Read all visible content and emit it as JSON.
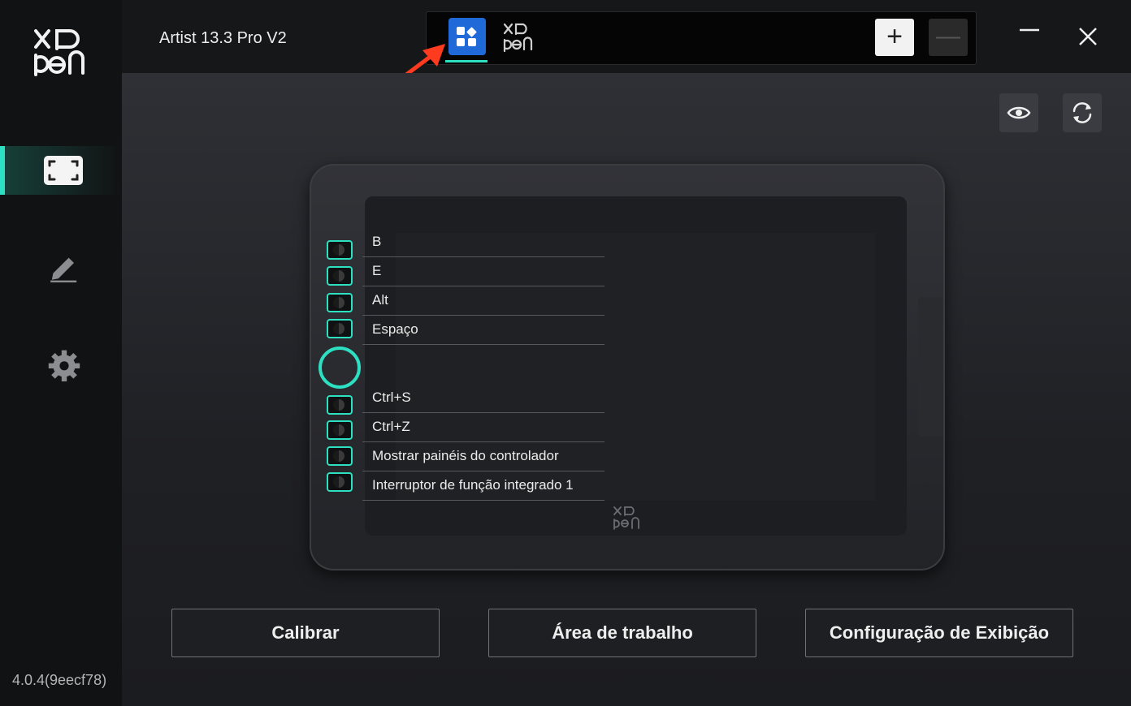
{
  "app": {
    "device_name": "Artist 13.3 Pro V2",
    "version": "4.0.4(9eecf78)",
    "brand_accent": "#2ee0c2"
  },
  "sidebar": {
    "items": [
      {
        "name": "display-area",
        "icon": "fullscreen-frame-icon",
        "active": true
      },
      {
        "name": "pen",
        "icon": "pen-icon",
        "active": false
      },
      {
        "name": "settings",
        "icon": "gear-icon",
        "active": false
      }
    ]
  },
  "tabs": {
    "apps_icon": "app-grid-icon",
    "xppen_icon": "xppen-logo-icon",
    "add_label": "+",
    "remove_label": "—"
  },
  "toolbar": {
    "preview_icon": "eye-icon",
    "reset_icon": "refresh-icon"
  },
  "express_keys": {
    "top": [
      "B",
      "E",
      "Alt",
      "Espaço"
    ],
    "bottom": [
      "Ctrl+S",
      "Ctrl+Z",
      "Mostrar painéis do controlador",
      "Interruptor de função integrado 1"
    ]
  },
  "actions": {
    "calibrate": "Calibrar",
    "work_area": "Área de trabalho",
    "display_settings": "Configuração de Exibição"
  }
}
